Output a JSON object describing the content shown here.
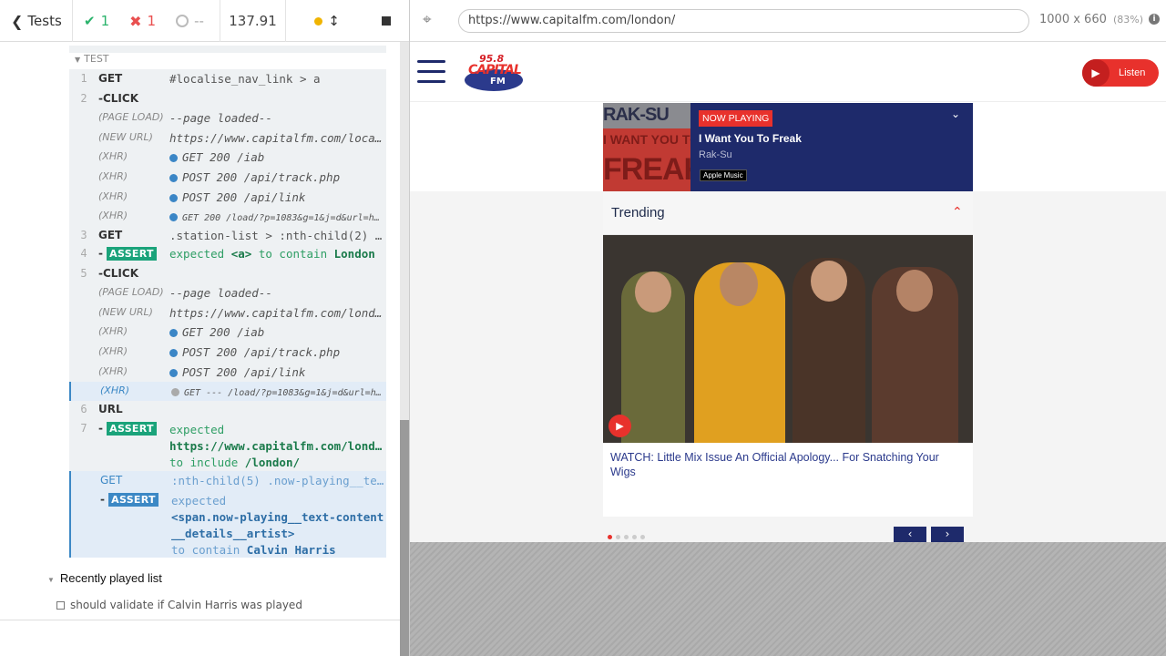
{
  "reporter": {
    "back_label": "Tests",
    "passed": "1",
    "failed": "1",
    "pending": "--",
    "duration": "137.91"
  },
  "log": {
    "section_label": "TEST",
    "rows": [
      {
        "num": "1",
        "cmd": "GET",
        "msg": "#localise_nav_link > a"
      },
      {
        "num": "2",
        "cmd": "-CLICK",
        "msg": ""
      },
      {
        "num": "",
        "cmd": "(PAGE LOAD)",
        "msg": "--page loaded--"
      },
      {
        "num": "",
        "cmd": "(NEW URL)",
        "msg": "https://www.capitalfm.com/local…"
      },
      {
        "num": "",
        "cmd": "(XHR)",
        "msg": "GET 200 /iab"
      },
      {
        "num": "",
        "cmd": "(XHR)",
        "msg": "POST 200 /api/track.php"
      },
      {
        "num": "",
        "cmd": "(XHR)",
        "msg": "POST 200 /api/link"
      },
      {
        "num": "",
        "cmd": "(XHR)",
        "msg": "GET 200 /load/?p=1083&g=1&j=d&url=h…"
      },
      {
        "num": "3",
        "cmd": "GET",
        "msg": ".station-list > :nth-child(2) >…"
      },
      {
        "num": "4",
        "cmd": "-ASSERT",
        "msg_a": "expected ",
        "msg_b": "<a>",
        "msg_c": " to contain ",
        "msg_d": "London"
      },
      {
        "num": "5",
        "cmd": "-CLICK",
        "msg": ""
      },
      {
        "num": "",
        "cmd": "(PAGE LOAD)",
        "msg": "--page loaded--"
      },
      {
        "num": "",
        "cmd": "(NEW URL)",
        "msg": "https://www.capitalfm.com/londo…"
      },
      {
        "num": "",
        "cmd": "(XHR)",
        "msg": "GET 200 /iab"
      },
      {
        "num": "",
        "cmd": "(XHR)",
        "msg": "POST 200 /api/track.php"
      },
      {
        "num": "",
        "cmd": "(XHR)",
        "msg": "POST 200 /api/link"
      },
      {
        "num": "",
        "cmd": "(XHR)",
        "msg": "GET --- /load/?p=1083&g=1&j=d&url=h…"
      },
      {
        "num": "6",
        "cmd": "URL",
        "msg": ""
      },
      {
        "num": "7",
        "cmd": "-ASSERT",
        "msg_a": "expected",
        "msg_b": "https://www.capitalfm.com/lond…",
        "msg_c": "to include",
        "msg_d": "/london/"
      },
      {
        "num": "",
        "cmd": "GET",
        "msg": ":nth-child(5) .now-playing__tex…"
      },
      {
        "num": "",
        "cmd": "-ASSERT",
        "msg_a": "expected",
        "msg_b": "<span.now-playing__text-content__details__artist>",
        "msg_c": "to contain",
        "msg_d": "Calvin Harris"
      }
    ]
  },
  "suite": {
    "title": "Recently played list",
    "test": "should validate if Calvin Harris was played"
  },
  "browser": {
    "url": "https://www.capitalfm.com/london/",
    "viewport": "1000 x 660",
    "zoom": "(83%)"
  },
  "site": {
    "logo_freq": "95.8",
    "logo_name": "CAPITAL",
    "logo_fm": "FM",
    "listen": "Listen",
    "now_playing": "NOW PLAYING",
    "song": "I Want You To Freak",
    "artist": "Rak-Su",
    "apple": "Apple Music",
    "art_text1": "RAK-SU",
    "art_text2": "I WANT YOU TO",
    "art_text3": "FREAK",
    "trending": "Trending",
    "headline": "WATCH: Little Mix Issue An Official Apology... For Snatching Your Wigs"
  }
}
